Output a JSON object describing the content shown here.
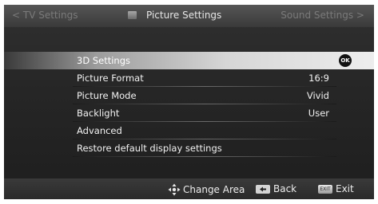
{
  "header": {
    "nav_left": "< TV Settings",
    "title": "Picture Settings",
    "nav_right": "Sound Settings >"
  },
  "menu": {
    "items": [
      {
        "label": "3D Settings",
        "value": "",
        "selected": true
      },
      {
        "label": "Picture Format",
        "value": "16:9"
      },
      {
        "label": "Picture Mode",
        "value": "Vivid"
      },
      {
        "label": "Backlight",
        "value": "User"
      },
      {
        "label": "Advanced",
        "value": ""
      },
      {
        "label": "Restore default display settings",
        "value": ""
      }
    ],
    "ok_badge": "OK"
  },
  "footer": {
    "change_area": "Change Area",
    "back": "Back",
    "exit_key": "EXIT",
    "exit": "Exit"
  }
}
